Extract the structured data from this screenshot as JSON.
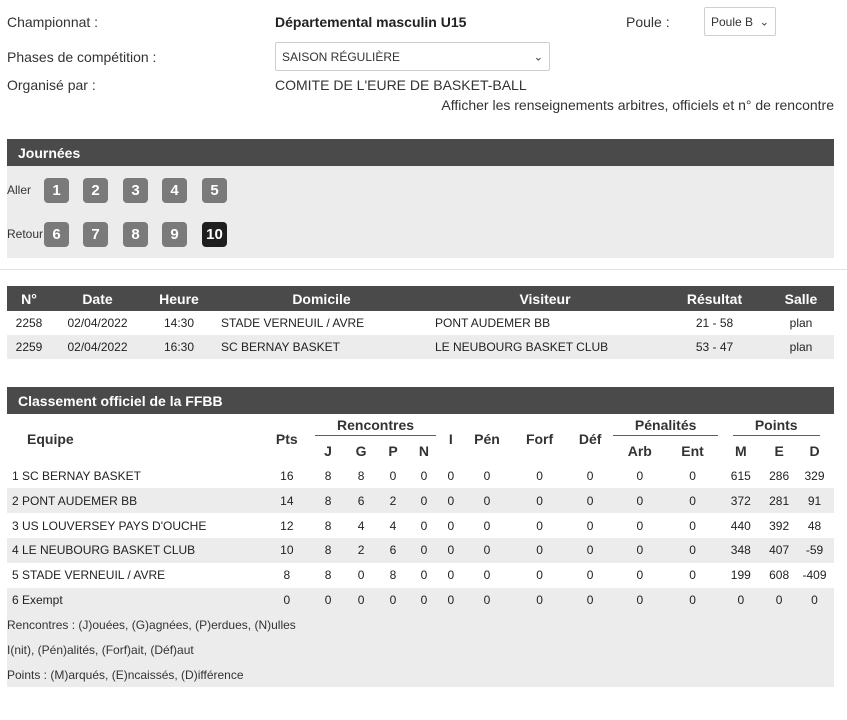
{
  "header": {
    "championnat_label": "Championnat :",
    "championnat_value": "Départemental masculin U15",
    "poule_label": "Poule :",
    "poule_value": "Poule B",
    "phases_label": "Phases de compétition :",
    "phases_value": "SAISON RÉGULIÈRE",
    "organise_label": "Organisé par :",
    "organise_value": "COMITE DE L'EURE DE BASKET-BALL",
    "details_link": "Afficher les renseignements arbitres, officiels et n° de rencontre"
  },
  "journees": {
    "title": "Journées",
    "aller_label": "Aller",
    "retour_label": "Retour",
    "aller": [
      "1",
      "2",
      "3",
      "4",
      "5"
    ],
    "retour": [
      "6",
      "7",
      "8",
      "9",
      "10"
    ],
    "active": "10"
  },
  "matches": {
    "headers": [
      "N°",
      "Date",
      "Heure",
      "Domicile",
      "Visiteur",
      "Résultat",
      "Salle"
    ],
    "rows": [
      [
        "2258",
        "02/04/2022",
        "14:30",
        "STADE VERNEUIL / AVRE",
        "PONT AUDEMER BB",
        "21 - 58",
        "plan"
      ],
      [
        "2259",
        "02/04/2022",
        "16:30",
        "SC BERNAY BASKET",
        "LE NEUBOURG BASKET CLUB",
        "53 - 47",
        "plan"
      ]
    ]
  },
  "standings": {
    "title": "Classement officiel de la FFBB",
    "h_equipe": "Equipe",
    "h_pts": "Pts",
    "h_rencontres": "Rencontres",
    "h_i": "I",
    "h_pen": "Pén",
    "h_forf": "Forf",
    "h_def": "Déf",
    "h_penalites": "Pénalités",
    "h_points": "Points",
    "sub_j": "J",
    "sub_g": "G",
    "sub_p": "P",
    "sub_n": "N",
    "sub_arb": "Arb",
    "sub_ent": "Ent",
    "sub_m": "M",
    "sub_e": "E",
    "sub_d": "D",
    "rows": [
      [
        "1 SC BERNAY BASKET",
        "16",
        "8",
        "8",
        "0",
        "0",
        "0",
        "0",
        "0",
        "0",
        "0",
        "0",
        "615",
        "286",
        "329"
      ],
      [
        "2 PONT AUDEMER BB",
        "14",
        "8",
        "6",
        "2",
        "0",
        "0",
        "0",
        "0",
        "0",
        "0",
        "0",
        "372",
        "281",
        "91"
      ],
      [
        "3 US LOUVERSEY PAYS D'OUCHE",
        "12",
        "8",
        "4",
        "4",
        "0",
        "0",
        "0",
        "0",
        "0",
        "0",
        "0",
        "440",
        "392",
        "48"
      ],
      [
        "4 LE NEUBOURG BASKET CLUB",
        "10",
        "8",
        "2",
        "6",
        "0",
        "0",
        "0",
        "0",
        "0",
        "0",
        "0",
        "348",
        "407",
        "-59"
      ],
      [
        "5 STADE VERNEUIL / AVRE",
        "8",
        "8",
        "0",
        "8",
        "0",
        "0",
        "0",
        "0",
        "0",
        "0",
        "0",
        "199",
        "608",
        "-409"
      ],
      [
        "6 Exempt",
        "0",
        "0",
        "0",
        "0",
        "0",
        "0",
        "0",
        "0",
        "0",
        "0",
        "0",
        "0",
        "0",
        "0"
      ]
    ],
    "legend": [
      "Rencontres : (J)ouées, (G)agnées, (P)erdues, (N)ulles",
      "I(nit), (Pén)alités, (Forf)ait, (Déf)aut",
      "Points : (M)arqués, (E)ncaissés, (D)ifférence"
    ]
  }
}
